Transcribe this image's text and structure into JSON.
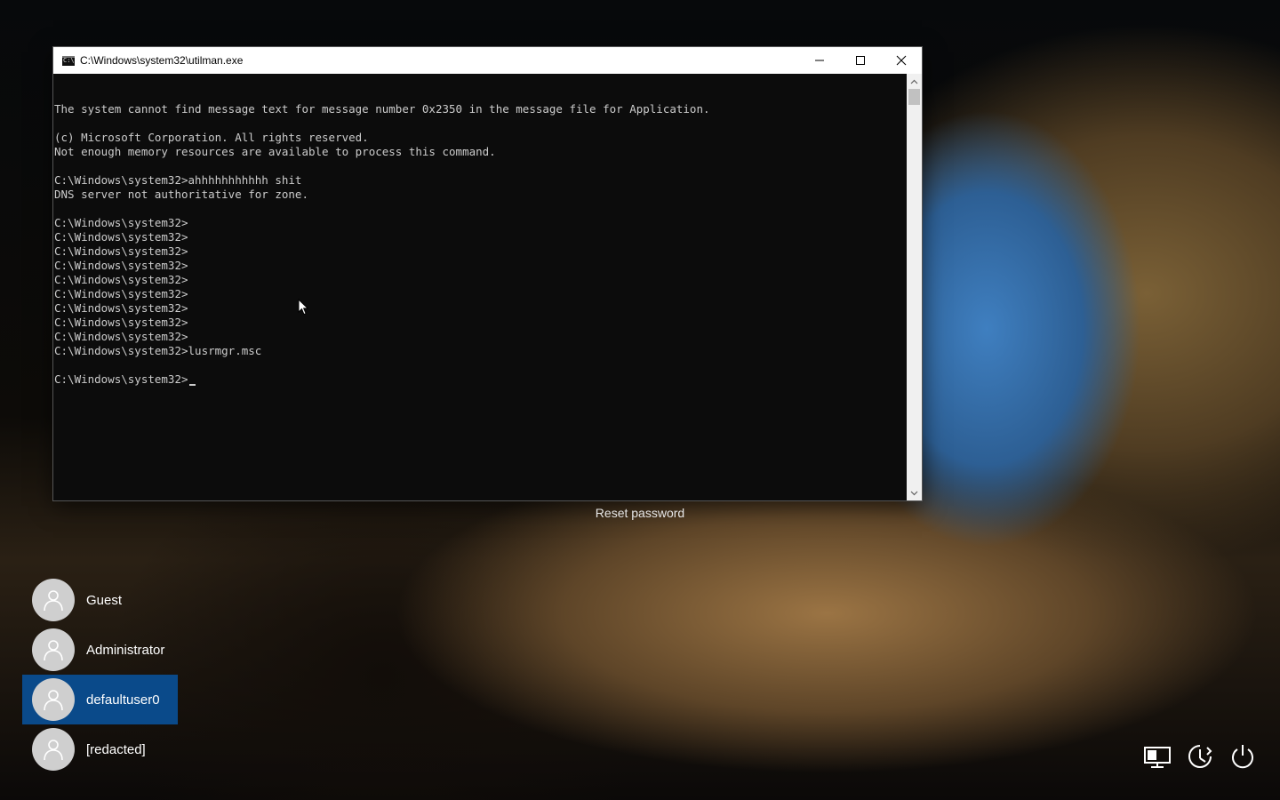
{
  "window": {
    "title": "C:\\Windows\\system32\\utilman.exe",
    "icon": "console-icon",
    "controls": [
      "minimize-icon",
      "maximize-icon",
      "close-icon"
    ]
  },
  "console": {
    "lines": [
      "The system cannot find message text for message number 0x2350 in the message file for Application.",
      "",
      "(c) Microsoft Corporation. All rights reserved.",
      "Not enough memory resources are available to process this command.",
      "",
      "C:\\Windows\\system32>ahhhhhhhhhhh shit",
      "DNS server not authoritative for zone.",
      "",
      "C:\\Windows\\system32>",
      "C:\\Windows\\system32>",
      "C:\\Windows\\system32>",
      "C:\\Windows\\system32>",
      "C:\\Windows\\system32>",
      "C:\\Windows\\system32>",
      "C:\\Windows\\system32>",
      "C:\\Windows\\system32>",
      "C:\\Windows\\system32>",
      "C:\\Windows\\system32>lusrmgr.msc",
      ""
    ],
    "prompt": "C:\\Windows\\system32>"
  },
  "login": {
    "reset_password": "Reset password",
    "users": [
      {
        "name": "Guest",
        "selected": false
      },
      {
        "name": "Administrator",
        "selected": false
      },
      {
        "name": "defaultuser0",
        "selected": true
      },
      {
        "name": "[redacted]",
        "selected": false
      }
    ],
    "selected_color": "#0a4a8a"
  },
  "corner_icons": [
    "network-icon",
    "ease-of-access-icon",
    "power-icon"
  ]
}
